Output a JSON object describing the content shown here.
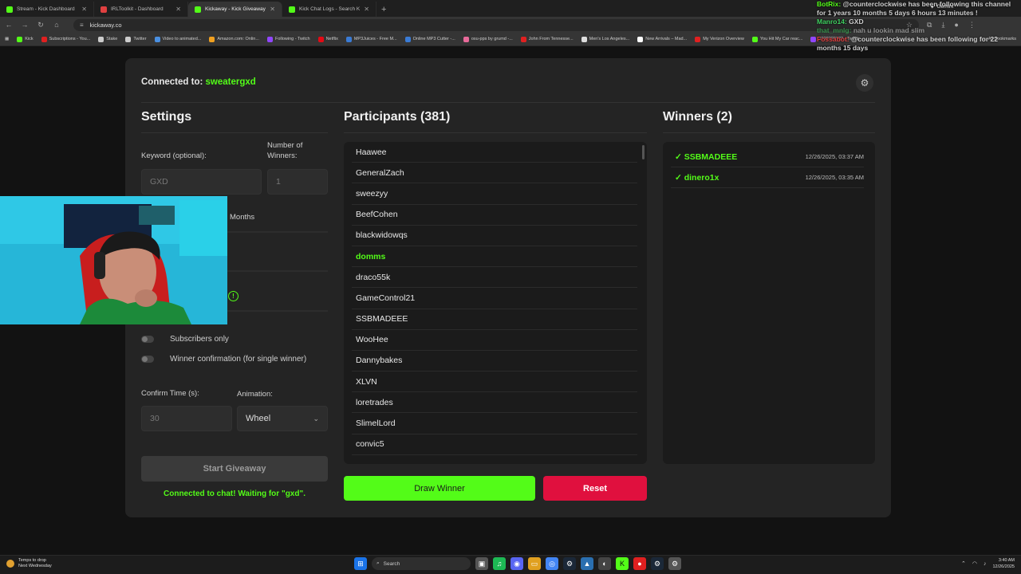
{
  "browser": {
    "tabs": [
      {
        "title": "Stream - Kick Dashboard",
        "color": "#53fc18"
      },
      {
        "title": "IRLToolkit - Dashboard",
        "color": "#e04040"
      },
      {
        "title": "Kickaway - Kick Giveaway Tool",
        "color": "#53fc18",
        "active": true
      },
      {
        "title": "Kick Chat Logs - Search Kick Cl",
        "color": "#53fc18"
      }
    ],
    "url": "kickaway.co",
    "bookmarks": [
      {
        "label": "Kick",
        "color": "#53fc18"
      },
      {
        "label": "Subscriptions - You...",
        "color": "#e02020"
      },
      {
        "label": "Stake",
        "color": "#cccccc"
      },
      {
        "label": "Twitter",
        "color": "#cccccc"
      },
      {
        "label": "Video to animated...",
        "color": "#4a90e2"
      },
      {
        "label": "Amazon.com: Onlin...",
        "color": "#f0a020"
      },
      {
        "label": "Following - Twitch",
        "color": "#9146ff"
      },
      {
        "label": "Netflix",
        "color": "#e50914"
      },
      {
        "label": "MP3Juices - Free M...",
        "color": "#3a7bd5"
      },
      {
        "label": "Online MP3 Cutter -...",
        "color": "#3a7bd5"
      },
      {
        "label": "osu-pps by grumd -...",
        "color": "#e86a9a"
      },
      {
        "label": "John From Tennesse...",
        "color": "#e02020"
      },
      {
        "label": "Men's Los Angeles...",
        "color": "#dddddd"
      },
      {
        "label": "New Arrivals – Mad...",
        "color": "#ffffff"
      },
      {
        "label": "My Verizon Overview",
        "color": "#e02020"
      },
      {
        "label": "You Hit My Car reac...",
        "color": "#53fc18"
      },
      {
        "label": "?????????? - Twitch",
        "color": "#9146ff"
      }
    ],
    "all_bookmarks": "All Bookmarks",
    "gemini": "Gemini"
  },
  "app": {
    "connected_prefix": "Connected to:",
    "channel": "sweatergxd",
    "settings": {
      "title": "Settings",
      "keyword_label": "Keyword (optional):",
      "keyword_placeholder": "GXD",
      "winners_label": "Number of Winners:",
      "winners_placeholder": "1",
      "months_label": "Months",
      "subscribers_only": "Subscribers only",
      "winner_confirmation": "Winner confirmation (for single winner)",
      "confirm_time_label": "Confirm Time (s):",
      "confirm_time_placeholder": "30",
      "animation_label": "Animation:",
      "animation_value": "Wheel",
      "start_button": "Start Giveaway",
      "status": "Connected to chat! Waiting for \"gxd\"."
    },
    "participants": {
      "title": "Participants (381)",
      "items": [
        "Haawee",
        "GeneralZach",
        "sweezyy",
        "BeefCohen",
        "blackwidowqs",
        "domms",
        "draco55k",
        "GameControl21",
        "SSBMADEEE",
        "WooHee",
        "Dannybakes",
        "XLVN",
        "loretrades",
        "SlimelLord",
        "convic5"
      ],
      "highlighted": "domms"
    },
    "winners": {
      "title": "Winners (2)",
      "items": [
        {
          "name": "✓ SSBMADEEE",
          "time": "12/26/2025, 03:37 AM"
        },
        {
          "name": "✓ dinero1x",
          "time": "12/26/2025, 03:35 AM"
        }
      ]
    },
    "draw_button": "Draw Winner",
    "reset_button": "Reset"
  },
  "chat_overlay": [
    {
      "user": "BotRix:",
      "text": "@counterclockwise has been following this channel for 1 years 10 months 5 days 6 hours 13 minutes !"
    },
    {
      "user": "Manro14:",
      "text": "GXD"
    },
    {
      "user": "that_mnlg:",
      "text": "nah u lookin mad slim"
    },
    {
      "user": "Fossabot:",
      "text": "@counterclockwise has been following for 22 months 15 days"
    }
  ],
  "taskbar": {
    "weather_line1": "Temps to drop",
    "weather_line2": "Next Wednesday",
    "search_placeholder": "Search",
    "time": "3:40 AM",
    "date": "12/26/2025"
  }
}
